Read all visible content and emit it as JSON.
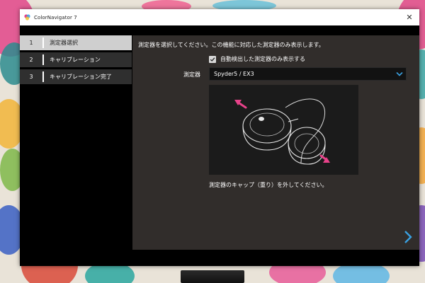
{
  "window": {
    "title": "ColorNavigator 7",
    "close_glyph": "✕"
  },
  "steps": [
    {
      "number": "1",
      "label": "測定器選択",
      "active": true
    },
    {
      "number": "2",
      "label": "キャリブレーション",
      "active": false
    },
    {
      "number": "3",
      "label": "キャリブレーション完了",
      "active": false
    }
  ],
  "panel": {
    "instruction": "測定器を選択してください。この機能に対応した測定器のみ表示します。",
    "auto_detect_label": "自動検出した測定器のみ表示する",
    "auto_detect_checked": true,
    "device_label": "測定器",
    "device_value": "Spyder5 / EX3",
    "caption": "測定器のキャップ（重り）を外してください。"
  },
  "icons": {
    "app": "colornavigator-icon",
    "checkbox": "checkmark-icon",
    "dropdown": "chevron-down-icon",
    "next": "chevron-right-icon"
  },
  "colors": {
    "accent": "#3aa0e0",
    "arrow_pink": "#e8428a",
    "panel_bg": "#312d2b"
  }
}
